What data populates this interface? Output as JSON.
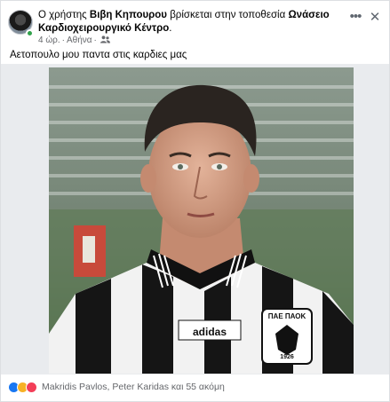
{
  "post": {
    "author_prefix": "Ο χρήστης ",
    "author_name": "Βιβη Κηπουρου",
    "location_prefix": " βρίσκεται στην τοποθεσία ",
    "location_name": "Ωνάσειο Καρδιοχειρουργικό Κέντρο",
    "location_suffix": ".",
    "time": "4 ώρ.",
    "place": "Αθήνα",
    "privacy_icon": "friends-icon",
    "text": "Αετοπουλο μου παντα στις καρδιες μας"
  },
  "actions": {
    "more_label": "•••",
    "close_label": "✕"
  },
  "photo": {
    "kit_brand": "adidas",
    "crest_text_top": "ΠΑΕ ΠΑΟΚ",
    "crest_year": "1926"
  },
  "reactions": {
    "icons": [
      "like-icon",
      "sad-icon",
      "love-icon"
    ],
    "names": "Makridis Pavlos, Peter Karidas και 55 ακόμη"
  },
  "colors": {
    "link": "#385898",
    "secondary_text": "#65676b",
    "like": "#1877f2",
    "sad": "#f7b125",
    "love": "#f33e58",
    "online": "#31a24c"
  }
}
